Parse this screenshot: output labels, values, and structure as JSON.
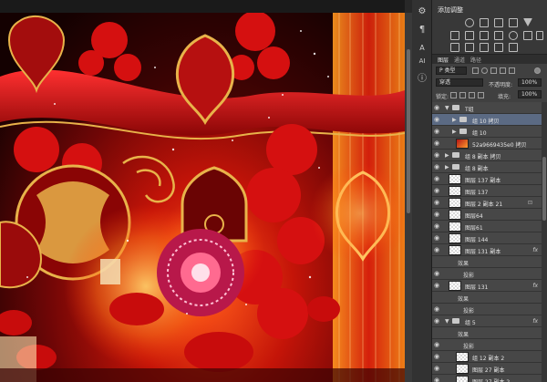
{
  "toolstrip": {
    "icons": [
      "sliders-icon",
      "paragraph-icon",
      "text-icon",
      "ai-icon",
      "info-icon"
    ],
    "glyphs": [
      "⚙",
      "¶",
      "A",
      "AI",
      "ⓘ"
    ]
  },
  "adjustments": {
    "title": "添加调整",
    "icons": [
      "brightness-icon",
      "levels-icon",
      "curves-icon",
      "exposure-icon",
      "gradient-map-icon",
      "vibrance-icon",
      "hue-icon",
      "color-balance-icon",
      "bw-icon",
      "photo-filter-icon",
      "channel-mixer-icon",
      "lookup-icon",
      "invert-icon",
      "posterize-icon",
      "threshold-icon",
      "selective-color-icon",
      "gradient-icon"
    ]
  },
  "layers_panel": {
    "tabs": [
      "图层",
      "通道",
      "路径"
    ],
    "kind_filter": "P 类型",
    "blend_mode": "穿透",
    "opacity_label": "不透明度:",
    "opacity_value": "100%",
    "lock_label": "锁定:",
    "fill_label": "填充:",
    "fill_value": "100%",
    "rows": [
      {
        "type": "group",
        "name": "T组",
        "indent": 0,
        "expanded": true
      },
      {
        "type": "group",
        "name": "组 10 拷贝",
        "indent": 1,
        "selected": true
      },
      {
        "type": "group",
        "name": "组 10",
        "indent": 1
      },
      {
        "type": "image",
        "name": "52a9669435e0 拷贝",
        "indent": 1
      },
      {
        "type": "group",
        "name": "组 8 副本 拷贝",
        "indent": 0
      },
      {
        "type": "group",
        "name": "组 8 副本",
        "indent": 0
      },
      {
        "type": "layer",
        "name": "图层 137 副本",
        "indent": 0
      },
      {
        "type": "layer",
        "name": "图层 137",
        "indent": 0
      },
      {
        "type": "layer",
        "name": "图层 2 副本 21",
        "indent": 0,
        "lock": true
      },
      {
        "type": "layer",
        "name": "图层64",
        "indent": 0
      },
      {
        "type": "layer",
        "name": "图层61",
        "indent": 0
      },
      {
        "type": "layer",
        "name": "图层 144",
        "indent": 0
      },
      {
        "type": "layer",
        "name": "图层 131 副本",
        "indent": 0,
        "fx": true
      },
      {
        "type": "effect",
        "name": "效果",
        "indent": 1
      },
      {
        "type": "effect",
        "name": "投影",
        "indent": 2
      },
      {
        "type": "layer",
        "name": "图层 131",
        "indent": 0,
        "fx": true
      },
      {
        "type": "effect",
        "name": "效果",
        "indent": 1
      },
      {
        "type": "effect",
        "name": "投影",
        "indent": 2
      },
      {
        "type": "group",
        "name": "组 5",
        "indent": 0,
        "expanded": true,
        "fx": true
      },
      {
        "type": "effect",
        "name": "效果",
        "indent": 1
      },
      {
        "type": "effect",
        "name": "投影",
        "indent": 2
      },
      {
        "type": "layer",
        "name": "组 12 副本 2",
        "indent": 1
      },
      {
        "type": "layer",
        "name": "图层 27 副本",
        "indent": 1
      },
      {
        "type": "layer",
        "name": "图层 27 副本 2",
        "indent": 1
      }
    ],
    "fx_label": "fx",
    "lock_glyph": "🔒",
    "eye_glyph": "👁"
  },
  "colors": {
    "panel_bg": "#404040",
    "selected_row": "#5b6a83",
    "artwork_red": "#c41408",
    "gold": "#e8b34a"
  }
}
